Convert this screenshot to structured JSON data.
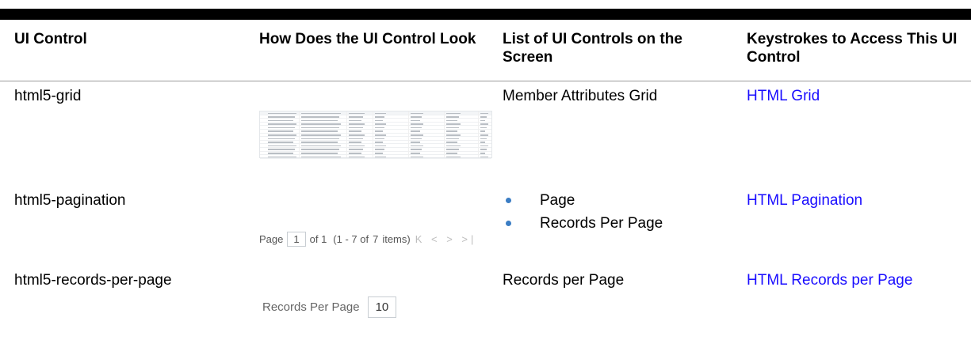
{
  "headers": {
    "col1": "UI Control",
    "col2": "How Does the UI Control Look",
    "col3": "List of UI Controls on the Screen",
    "col4": "Keystrokes to Access This UI Control"
  },
  "rows": [
    {
      "control": "html5-grid",
      "controls_text": "Member Attributes Grid",
      "link": "HTML Grid"
    },
    {
      "control": "html5-pagination",
      "controls_list": [
        "Page",
        "Records Per Page"
      ],
      "link": "HTML Pagination",
      "preview": {
        "page_label": "Page",
        "page_value": "1",
        "of_label": "of 1",
        "range": "(1 - 7 of",
        "total": "7",
        "items": "items)",
        "nav": "K < > >|"
      }
    },
    {
      "control": "html5-records-per-page",
      "controls_text": "Records per Page",
      "link": "HTML Records per Page",
      "preview": {
        "label": "Records Per Page",
        "value": "10"
      }
    }
  ],
  "colors": {
    "link": "#1a0dff",
    "bullet": "#3b7dc4",
    "top_bar": "#000000"
  }
}
